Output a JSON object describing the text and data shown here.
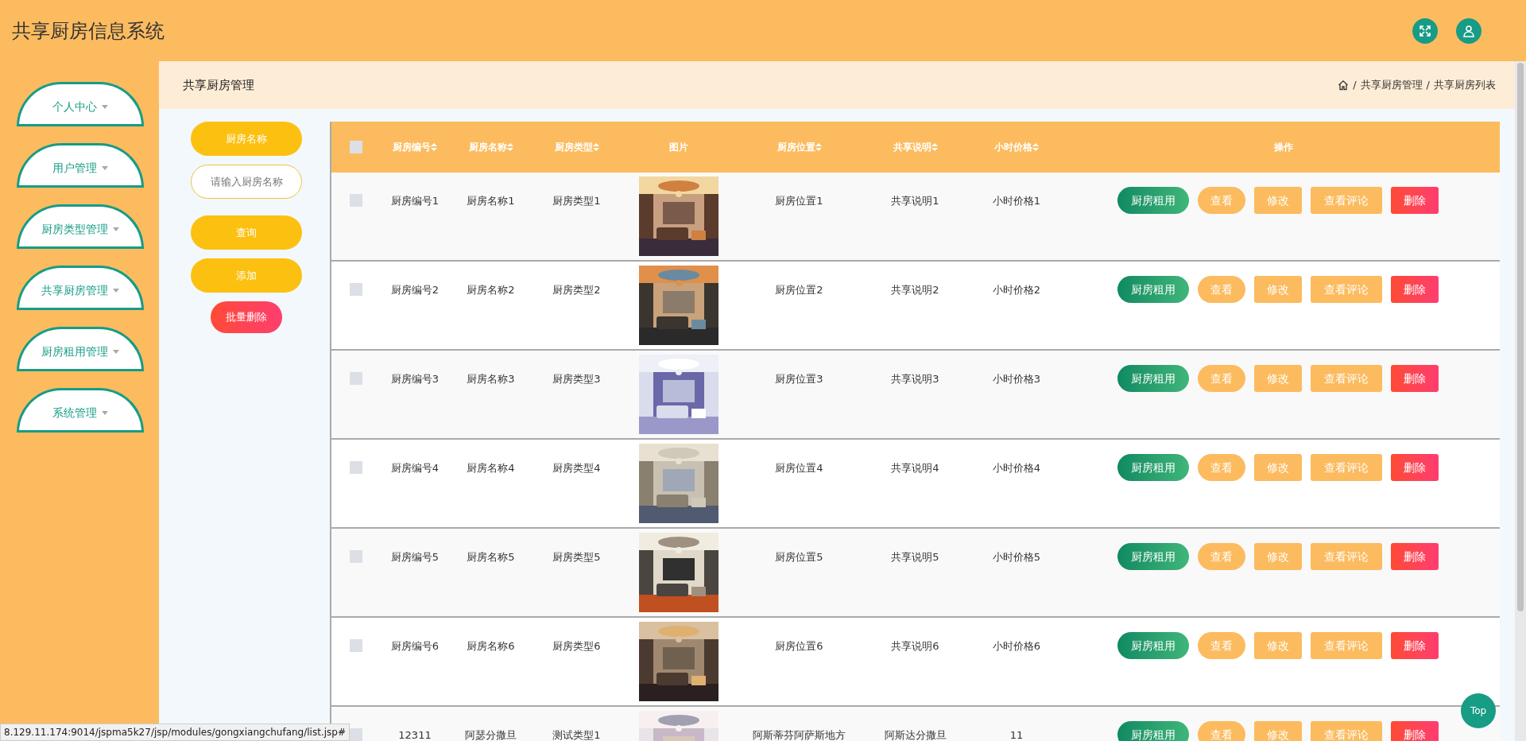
{
  "header": {
    "title": "共享厨房信息系统"
  },
  "sidebar": {
    "items": [
      {
        "label": "个人中心"
      },
      {
        "label": "用户管理"
      },
      {
        "label": "厨房类型管理"
      },
      {
        "label": "共享厨房管理"
      },
      {
        "label": "厨房租用管理"
      },
      {
        "label": "系统管理"
      }
    ]
  },
  "breadcrumb": {
    "title": "共享厨房管理",
    "path": [
      {
        "separator": "/",
        "label": "共享厨房管理"
      },
      {
        "separator": "/",
        "label": "共享厨房列表"
      }
    ]
  },
  "search": {
    "label": "厨房名称",
    "placeholder": "请输入厨房名称",
    "buttons": [
      {
        "label": "查询",
        "kind": "primary"
      },
      {
        "label": "添加",
        "kind": "primary"
      },
      {
        "label": "批量删除",
        "kind": "danger"
      }
    ]
  },
  "table": {
    "header_checked": false,
    "columns": [
      {
        "label": "厨房编号",
        "kind": "text",
        "sortable": true
      },
      {
        "label": "厨房名称",
        "kind": "text",
        "sortable": true
      },
      {
        "label": "厨房类型",
        "kind": "text",
        "sortable": true
      },
      {
        "label": "图片",
        "kind": "picture",
        "sortable": false
      },
      {
        "label": "厨房位置",
        "kind": "text",
        "sortable": true
      },
      {
        "label": "共享说明",
        "kind": "text",
        "sortable": true
      },
      {
        "label": "小时价格",
        "kind": "text",
        "sortable": true
      },
      {
        "label": "操作",
        "kind": "actions",
        "sortable": false
      }
    ],
    "rows": [
      {
        "checked": false,
        "cells": [
          "厨房编号1",
          "厨房名称1",
          "厨房类型1",
          {
            "kind": "picture"
          },
          "厨房位置1",
          "共享说明1",
          "小时价格1"
        ],
        "actions": [
          {
            "label": "厨房租用",
            "kind": "rent"
          },
          {
            "label": "查看",
            "kind": "view"
          },
          {
            "label": "修改",
            "kind": "edit"
          },
          {
            "label": "查看评论",
            "kind": "comments"
          },
          {
            "label": "删除",
            "kind": "delete"
          }
        ]
      },
      {
        "checked": false,
        "cells": [
          "厨房编号2",
          "厨房名称2",
          "厨房类型2",
          {
            "kind": "picture"
          },
          "厨房位置2",
          "共享说明2",
          "小时价格2"
        ],
        "actions": [
          {
            "label": "厨房租用",
            "kind": "rent"
          },
          {
            "label": "查看",
            "kind": "view"
          },
          {
            "label": "修改",
            "kind": "edit"
          },
          {
            "label": "查看评论",
            "kind": "comments"
          },
          {
            "label": "删除",
            "kind": "delete"
          }
        ]
      },
      {
        "checked": false,
        "cells": [
          "厨房编号3",
          "厨房名称3",
          "厨房类型3",
          {
            "kind": "picture"
          },
          "厨房位置3",
          "共享说明3",
          "小时价格3"
        ],
        "actions": [
          {
            "label": "厨房租用",
            "kind": "rent"
          },
          {
            "label": "查看",
            "kind": "view"
          },
          {
            "label": "修改",
            "kind": "edit"
          },
          {
            "label": "查看评论",
            "kind": "comments"
          },
          {
            "label": "删除",
            "kind": "delete"
          }
        ]
      },
      {
        "checked": false,
        "cells": [
          "厨房编号4",
          "厨房名称4",
          "厨房类型4",
          {
            "kind": "picture"
          },
          "厨房位置4",
          "共享说明4",
          "小时价格4"
        ],
        "actions": [
          {
            "label": "厨房租用",
            "kind": "rent"
          },
          {
            "label": "查看",
            "kind": "view"
          },
          {
            "label": "修改",
            "kind": "edit"
          },
          {
            "label": "查看评论",
            "kind": "comments"
          },
          {
            "label": "删除",
            "kind": "delete"
          }
        ]
      },
      {
        "checked": false,
        "cells": [
          "厨房编号5",
          "厨房名称5",
          "厨房类型5",
          {
            "kind": "picture"
          },
          "厨房位置5",
          "共享说明5",
          "小时价格5"
        ],
        "actions": [
          {
            "label": "厨房租用",
            "kind": "rent"
          },
          {
            "label": "查看",
            "kind": "view"
          },
          {
            "label": "修改",
            "kind": "edit"
          },
          {
            "label": "查看评论",
            "kind": "comments"
          },
          {
            "label": "删除",
            "kind": "delete"
          }
        ]
      },
      {
        "checked": false,
        "cells": [
          "厨房编号6",
          "厨房名称6",
          "厨房类型6",
          {
            "kind": "picture"
          },
          "厨房位置6",
          "共享说明6",
          "小时价格6"
        ],
        "actions": [
          {
            "label": "厨房租用",
            "kind": "rent"
          },
          {
            "label": "查看",
            "kind": "view"
          },
          {
            "label": "修改",
            "kind": "edit"
          },
          {
            "label": "查看评论",
            "kind": "comments"
          },
          {
            "label": "删除",
            "kind": "delete"
          }
        ]
      },
      {
        "checked": false,
        "cells": [
          "12311",
          "阿瑟分撒旦",
          "测试类型1",
          {
            "kind": "picture"
          },
          "阿斯蒂芬阿萨斯地方",
          "阿斯达分撒旦",
          "11"
        ],
        "actions": [
          {
            "label": "厨房租用",
            "kind": "rent"
          },
          {
            "label": "查看",
            "kind": "view"
          },
          {
            "label": "修改",
            "kind": "edit"
          },
          {
            "label": "查看评论",
            "kind": "comments"
          },
          {
            "label": "删除",
            "kind": "delete"
          }
        ]
      }
    ]
  },
  "back_to_top": {
    "label": "Top"
  },
  "status_bar": {
    "url": "8.129.11.174:9014/jspma5k27/jsp/modules/gongxiangchufang/list.jsp#"
  }
}
